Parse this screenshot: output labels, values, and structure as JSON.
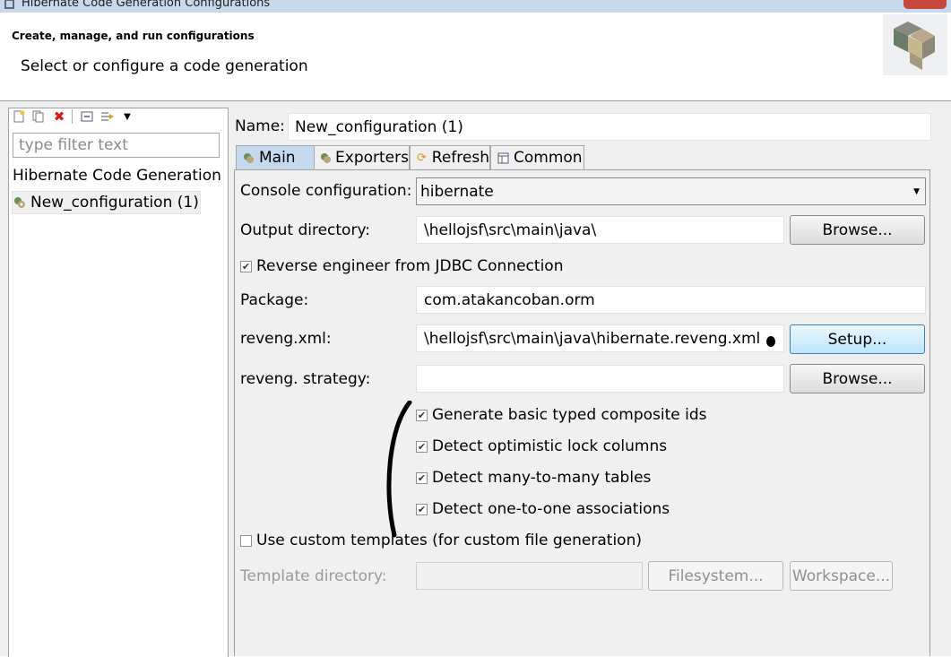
{
  "window": {
    "title": "Hibernate Code Generation Configurations"
  },
  "header": {
    "title": "Create, manage, and run configurations",
    "message": "Select or configure a code generation"
  },
  "sidebar": {
    "filter_placeholder": "type filter text",
    "tree": {
      "root": "Hibernate Code Generation",
      "child": "New_configuration (1)"
    }
  },
  "config": {
    "name_label": "Name:",
    "name_value": "New_configuration (1)"
  },
  "tabs": [
    {
      "label": "Main",
      "icon": "launch-icon",
      "active": true
    },
    {
      "label": "Exporters",
      "icon": "launch-icon",
      "active": false
    },
    {
      "label": "Refresh",
      "icon": "refresh-icon",
      "active": false
    },
    {
      "label": "Common",
      "icon": "common-table-icon",
      "active": false
    }
  ],
  "main": {
    "console_label": "Console configuration:",
    "console_value": "hibernate",
    "output_label": "Output directory:",
    "output_value": "\\hellojsf\\src\\main\\java\\",
    "browse_label": "Browse...",
    "reverse_label": "Reverse engineer from JDBC Connection",
    "reverse_checked": true,
    "package_label": "Package:",
    "package_value": "com.atakancoban.orm",
    "reveng_label": "reveng.xml:",
    "reveng_value": "\\hellojsf\\src\\main\\java\\hibernate.reveng.xml",
    "setup_label": "Setup...",
    "strategy_label": "reveng. strategy:",
    "strategy_value": "",
    "strategy_browse_label": "Browse...",
    "options": [
      {
        "label": "Generate basic typed composite ids",
        "checked": true
      },
      {
        "label": "Detect optimistic lock columns",
        "checked": true
      },
      {
        "label": "Detect many-to-many tables",
        "checked": true
      },
      {
        "label": "Detect one-to-one associations",
        "checked": true
      }
    ],
    "custom_templates_label": "Use custom templates (for custom file generation)",
    "custom_templates_checked": false,
    "template_dir_label": "Template directory:",
    "template_dir_value": "",
    "filesystem_label": "Filesystem...",
    "workspace_label": "Workspace..."
  },
  "colors": {
    "tab_active": "#c5d9ee",
    "focus_border": "#3c7fb1",
    "titlebar": "#c9d9ec"
  }
}
